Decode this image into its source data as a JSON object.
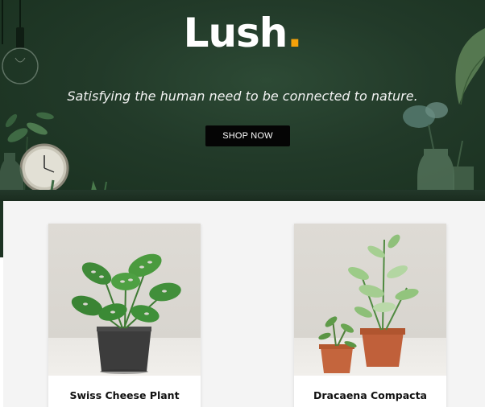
{
  "hero": {
    "brand": "Lush",
    "brand_dot": ".",
    "tagline": "Satisfying the human need to be connected to nature.",
    "cta_label": "SHOP NOW"
  },
  "products": [
    {
      "name": "Swiss Cheese Plant",
      "image_icon": "monstera-plant-icon"
    },
    {
      "name": "Dracaena Compacta",
      "image_icon": "dracaena-plant-icon"
    }
  ],
  "colors": {
    "hero_bg": "#223a29",
    "brand_accent": "#f5a20a",
    "button_bg": "#050505",
    "section_bg": "#f4f4f4"
  }
}
